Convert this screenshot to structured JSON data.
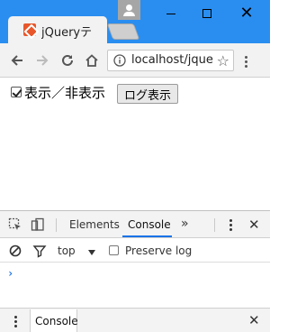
{
  "browser": {
    "tab_title": "jQueryテ",
    "url": "localhost/jque",
    "window_controls": {
      "minimize": "minimize-icon",
      "maximize": "maximize-icon",
      "close": "✕"
    },
    "accent_color": "#2a8ef0"
  },
  "page": {
    "checkbox_label": "表示／非表示",
    "checkbox_checked": true,
    "log_button_label": "ログ表示"
  },
  "devtools": {
    "tabs": [
      {
        "label": "Elements",
        "active": false
      },
      {
        "label": "Console",
        "active": true
      }
    ],
    "more_tabs": "»",
    "context": "top",
    "preserve_log_label": "Preserve log",
    "prompt_glyph": "›",
    "drawer_tab_label": "Console",
    "close_glyph": "✕"
  }
}
